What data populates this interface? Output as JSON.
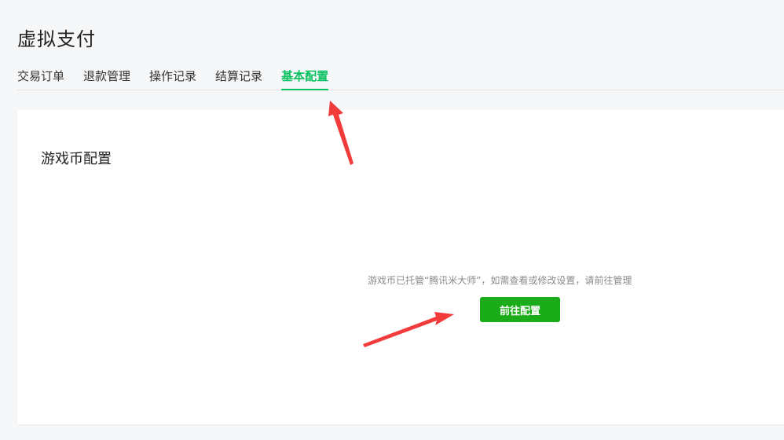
{
  "header": {
    "title": "虚拟支付"
  },
  "tabs": [
    {
      "label": "交易订单",
      "active": false
    },
    {
      "label": "退款管理",
      "active": false
    },
    {
      "label": "操作记录",
      "active": false
    },
    {
      "label": "结算记录",
      "active": false
    },
    {
      "label": "基本配置",
      "active": true
    }
  ],
  "section": {
    "title": "游戏币配置",
    "info": "游戏币已托管“腾讯米大师”，如需查看或修改设置，请前往管理",
    "button_label": "前往配置"
  },
  "colors": {
    "accent": "#07c160",
    "button": "#1aad19",
    "annotation_arrow": "#f23c3c"
  },
  "icons": {
    "annotation_tab": "red-arrow-icon",
    "annotation_button": "red-arrow-icon"
  }
}
